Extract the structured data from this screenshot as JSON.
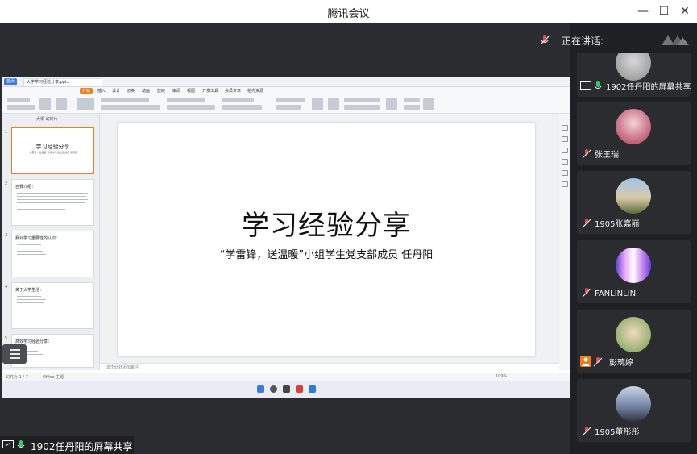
{
  "app": {
    "title": "腾讯会议"
  },
  "window_controls": {
    "minimize": "—",
    "maximize": "☐",
    "close": "✕"
  },
  "speaking": {
    "label": "正在讲话:"
  },
  "share": {
    "label": "1902任丹阳的屏幕共享"
  },
  "wps": {
    "home_tab": "首页",
    "doc_tab": "大学学习经验分享.pptx",
    "menu": [
      "开始",
      "插入",
      "设计",
      "切换",
      "动画",
      "放映",
      "审阅",
      "视图",
      "开发工具",
      "会员专享",
      "稻壳资源"
    ],
    "thumb_tabs": "大纲   幻灯片",
    "notes_placeholder": "单击此处添加备注",
    "status_left": "幻灯片 1 / 7",
    "status_theme": "Office 主题",
    "zoom": "109%",
    "thumbnails": [
      {
        "num": "1",
        "title": "学习经验分享",
        "sub": "“学雷锋，送温暖”小组学生党支部成员 任丹阳"
      },
      {
        "num": "2",
        "title": "自我介绍："
      },
      {
        "num": "3",
        "title": "我对学习重要性的认识："
      },
      {
        "num": "4",
        "title": "关于大学生活："
      },
      {
        "num": "5",
        "title": "高效学习经验分享："
      }
    ]
  },
  "slide": {
    "title": "学习经验分享",
    "subtitle": "“学雷锋，送温暖”小组学生党支部成员  任丹阳"
  },
  "participants": [
    {
      "name": "1902任丹阳的屏幕共享",
      "icon": "screen-share-icon"
    },
    {
      "name": "张王瑞",
      "icon": "mic-muted-icon"
    },
    {
      "name": "1905张嘉丽",
      "icon": "mic-muted-icon"
    },
    {
      "name": "FANLINLIN",
      "icon": "mic-muted-icon"
    },
    {
      "name": "彭琬婷",
      "icon": "user-icon"
    },
    {
      "name": "1905董彤彤",
      "icon": "mic-muted-icon"
    }
  ],
  "colors": {
    "accent": "#f07e1a",
    "wps_blue": "#3b7be0",
    "background": "#1b1c1f"
  }
}
